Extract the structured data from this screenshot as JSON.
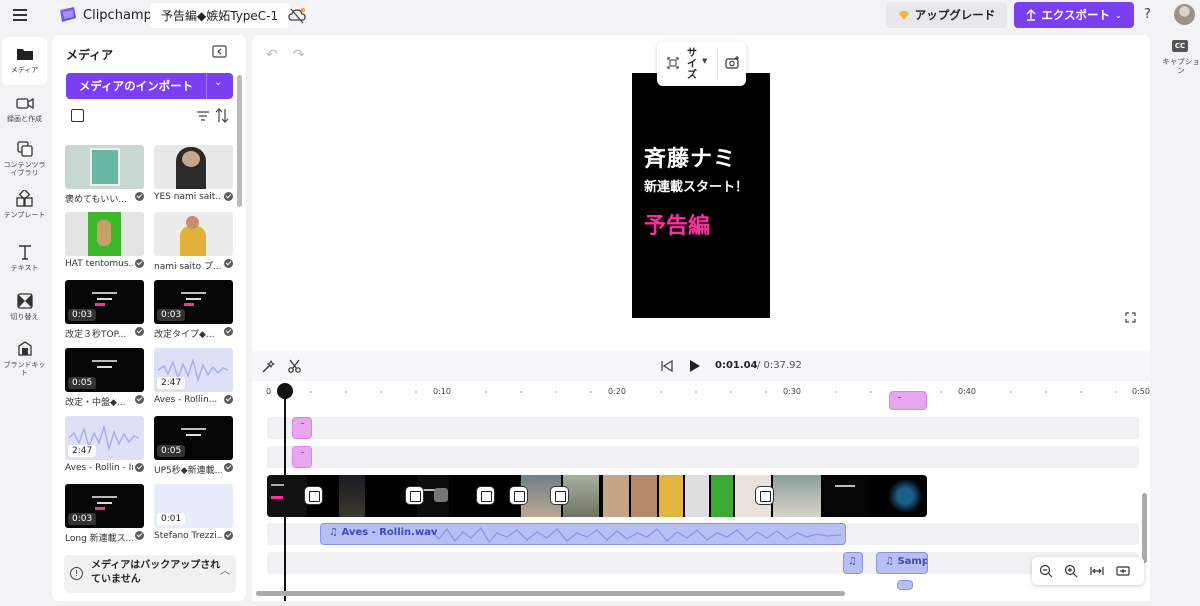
{
  "topbar": {
    "app_name": "Clipchamp",
    "project_title": "予告編◆嫉妬TypeC-1",
    "upgrade_label": "アップグレード",
    "export_label": "エクスポート",
    "help_label": "?"
  },
  "rail": {
    "items": [
      {
        "label": "メディア",
        "icon": "folder-icon"
      },
      {
        "label": "録画と作成",
        "icon": "camera-icon"
      },
      {
        "label": "コンテンツライブラリ",
        "icon": "library-icon"
      },
      {
        "label": "テンプレート",
        "icon": "template-icon"
      },
      {
        "label": "テキスト",
        "icon": "text-icon"
      },
      {
        "label": "切り替え",
        "icon": "transition-icon"
      },
      {
        "label": "ブランドキット",
        "icon": "brand-icon"
      }
    ]
  },
  "media_panel": {
    "title": "メディア",
    "import_label": "メディアのインポート",
    "items": [
      {
        "name": "褒めてもいい...",
        "duration": ""
      },
      {
        "name": "YES nami sait...",
        "duration": ""
      },
      {
        "name": "HAT tentomus...",
        "duration": ""
      },
      {
        "name": "nami saito プ...",
        "duration": ""
      },
      {
        "name": "改定３秒TOP...",
        "duration": "0:03"
      },
      {
        "name": "改定タイプ◆...",
        "duration": "0:03"
      },
      {
        "name": "改定・中盤◆...",
        "duration": "0:05"
      },
      {
        "name": "Aves - Rollin...",
        "duration": "2:47"
      },
      {
        "name": "Aves - Rollin - In...",
        "duration": "2:47"
      },
      {
        "name": "UP5秒◆新連載...",
        "duration": "0:05"
      },
      {
        "name": "Long 新連載ス...",
        "duration": "0:03"
      },
      {
        "name": "Stefano Trezzi...",
        "duration": "0:01"
      }
    ],
    "backup_notice": "メディアはバックアップされていません"
  },
  "preview": {
    "size_label": "サイズ",
    "video_title_line1": "斉藤ナミ",
    "video_title_line2": "新連載スタート！",
    "video_title_line3": "予告編"
  },
  "playback": {
    "current_time": "0:01.04",
    "total_time": "/ 0:37.92"
  },
  "timeline": {
    "ruler_labels": [
      "0",
      "0:10",
      "0:20",
      "0:30",
      "0:40",
      "0:50"
    ],
    "audio_clips": [
      {
        "label": "Aves - Rollin.wav"
      },
      {
        "label": "Samp"
      }
    ]
  },
  "captions": {
    "label": "キャプション"
  },
  "colors": {
    "accent": "#7b3ff2",
    "sticker": "#e7a6ef",
    "audio": "#b7bff3",
    "title_pink": "#ff2ea3"
  }
}
